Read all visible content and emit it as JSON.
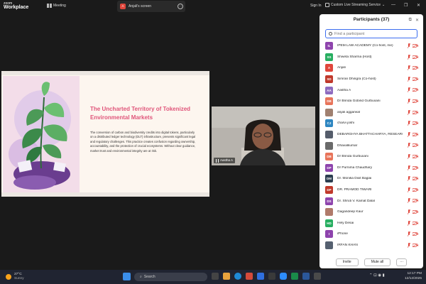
{
  "app": {
    "logo_line1": "zoom",
    "logo_line2": "Workplace",
    "meeting_label": "Meeting",
    "screen_tab_initial": "A",
    "screen_tab_label": "Anjali's screen",
    "signin": "Sign In",
    "live_stream": "Custom Live Streaming Service",
    "more_glyph": "···"
  },
  "slide": {
    "title": "The Uncharted Territory of Tokenized Environmental Markets",
    "body": "The conversion of carbon and biodiversity credits into digital tokens, particularly on a distributed ledger technology (DLT) infrastructure, presents significant legal and regulatory challenges. This practice creates confusion regarding ownership, accountability, and the protection of crucial ecosystems. Without clear guidance, market trust and environmental integrity are at risk.",
    "accent_color": "#e0557a"
  },
  "video": {
    "name": "Aastha A"
  },
  "participants": {
    "title": "Participants (37)",
    "search_placeholder": "Find a participant",
    "list": [
      {
        "initials": "IL",
        "name": "IPEM LAW ACADEMY (Co-host, me)",
        "color": "#8e44ad"
      },
      {
        "initials": "SS",
        "name": "Shweta Sharma (Host)",
        "color": "#27ae60"
      },
      {
        "initials": "A",
        "name": "Anjali",
        "color": "#e0463c"
      },
      {
        "initials": "SD",
        "name": "Simran Dhingra (Co-host)",
        "color": "#c0392b"
      },
      {
        "initials": "AA",
        "name": "Aastha A",
        "color": "#8e6bbf"
      },
      {
        "initials": "DB",
        "name": "Dr Brinda Gobind Gurbuxani",
        "color": "#e8745a"
      },
      {
        "initials": "",
        "name": "anjali aggarwal",
        "color": "#a08070"
      },
      {
        "initials": "CJ",
        "name": "charvi joshi",
        "color": "#2e86c1"
      },
      {
        "initials": "",
        "name": "DEBARGHYA BHATTACHARYA, RESEARCH...",
        "color": "#555d6b"
      },
      {
        "initials": "",
        "name": "Dhavalkumar",
        "color": "#6a6a6a"
      },
      {
        "initials": "DB",
        "name": "Dr Brinda Gurbuxani",
        "color": "#e8745a"
      },
      {
        "initials": "DP",
        "name": "Dr Purnima Chaudhary",
        "color": "#8e44ad"
      },
      {
        "initials": "DM",
        "name": "Dr. Monika Dixit Bajpai",
        "color": "#2c3e50"
      },
      {
        "initials": "DP",
        "name": "DR. PRAMOD TIWARI",
        "color": "#c0392b"
      },
      {
        "initials": "DS",
        "name": "Dr. Shruti V. Kamat Dalal",
        "color": "#8e44ad"
      },
      {
        "initials": "",
        "name": "Gagandeep Kaur",
        "color": "#b07a6a"
      },
      {
        "initials": "HD",
        "name": "Hely Desai",
        "color": "#27ae60"
      },
      {
        "initials": "I",
        "name": "iPhone",
        "color": "#8e44ad"
      },
      {
        "initials": "",
        "name": "IRFAN KHAN",
        "color": "#556070"
      }
    ],
    "invite_label": "Invite",
    "mute_all_label": "Mute all",
    "more_label": "···"
  },
  "taskbar": {
    "temp": "27°C",
    "weather": "Sunny",
    "search_placeholder": "Search",
    "time": "12:17 PM",
    "date": "12/12/2025"
  }
}
